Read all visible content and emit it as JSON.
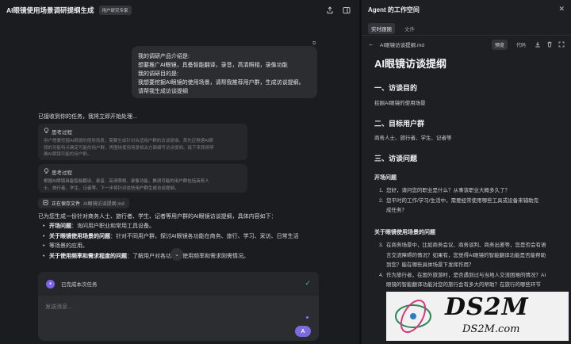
{
  "chat": {
    "title": "AI眼镜使用场景调研提纲生成",
    "badge": "用户研究专家",
    "user_message": [
      "我的调研产品介绍是:",
      "想要推广AI眼镜，具备智能翻译，录音，高清照相，录像功能",
      "我的调研目的是:",
      "我想要挖掘AI眼镜的使用场景，请帮我推荐用户群，生成访谈提纲。",
      "请帮我生成访谈提纲"
    ],
    "ack": "已接收到你的任务，我将立即开始处理...",
    "think_label": "思考过程",
    "think_1": [
      "用户想要挖掘AI眼镜的使用场景，需要生成针对合适用户群的访谈提纲。首先应根据AI眼",
      "镜的功能特点确定可能的用户群，再围绕使用场景相关方面编写访谈提纲。接下来我将明",
      "确AI眼镜可能的用户群。"
    ],
    "think_2": [
      "根据AI眼镜具备智能翻译、录音、高清照相、录像功能，推测可能的用户群包括商务人",
      "士、旅行者、学生、记者等。下一步将针对这些用户群生成访谈提纲。"
    ],
    "saving_label": "正在保存文件",
    "saving_file": "AI眼镜访谈提纲.md",
    "desc": "已为您生成一份针对商务人士、旅行者、学生、记者等用户群的AI眼镜访谈提纲，具体内容如下：",
    "bullets": [
      {
        "bold": "开场问题",
        "text": "：询问用户职业和常用工具设备。"
      },
      {
        "bold": "关于眼镜使用场景的问题",
        "text": "：针对不同用户群，探讨AI眼镜各功能在商务、旅行、学习、采访、日常生活"
      },
      {
        "bold": "",
        "text": "等场景的应用。",
        "cont": true
      },
      {
        "bold": "关于使用频率和需求程度的问题",
        "text": "：了解用户对各功能的使用频率和需求刚需情况。"
      }
    ],
    "task_label": "已完成本次任务",
    "input_placeholder": "发送消息...",
    "send_label": "A"
  },
  "workspace": {
    "title": "Agent 的工作空间",
    "tabs": [
      {
        "label": "实时跟随",
        "active": true
      },
      {
        "label": "文件",
        "active": false
      }
    ],
    "file_name": "AI眼镜访谈提纲.md",
    "preview_label": "预览",
    "code_label": "代码"
  },
  "doc": {
    "h1": "AI眼镜访谈提纲",
    "s1_title": "一、访谈目的",
    "s1_text": "挖掘AI眼镜的使用场景",
    "s2_title": "二、目标用户群",
    "s2_text": "商务人士、旅行者、学生、记者等",
    "s3_title": "三、访谈问题",
    "sub1": "开场问题",
    "sub1_items": [
      {
        "num": "1.",
        "text": "您好，请问您的职业是什么？从事该职业大概多久了？"
      },
      {
        "num": "2.",
        "text": "您平时的工作/学习/生活中，需要经常使用哪些工具或设备来辅助完"
      },
      {
        "num": "",
        "text": "成任务？"
      }
    ],
    "sub2": "关于眼镜使用场景的问题",
    "sub2_items": [
      {
        "num": "3.",
        "text": "在商务场景中，比如商务会议、商务谈判、商务出差等，您是否会有语"
      },
      {
        "num": "",
        "text": "言交流障碍的情况？如果有，您觉得AI眼镜的智能翻译功能是否能帮助"
      },
      {
        "num": "",
        "text": "到您？能在哪些具体场景下发挥作用？"
      },
      {
        "num": "4.",
        "text": "作为旅行者，在国外旅游时，是否遇到过与当地人交流困难的情况？AI"
      },
      {
        "num": "",
        "text": "眼镜的智能翻译功能对您的旅行会有多大的帮助？在旅行的哪些环节"
      }
    ]
  },
  "watermark": {
    "brand": "DS2M",
    "url": "DS2M.com"
  }
}
